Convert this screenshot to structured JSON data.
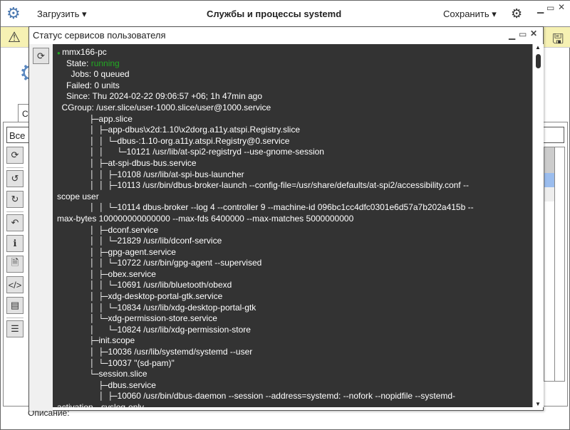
{
  "header": {
    "load_label": "Загрузить",
    "title": "Службы и процессы systemd",
    "save_label": "Сохранить"
  },
  "background": {
    "tab_label": "С",
    "filter_value": "Все",
    "description_label": "Описание:"
  },
  "dialog": {
    "title": "Статус сервисов пользователя",
    "status_color": "#22aa22",
    "lines": [
      {
        "p": "",
        "t": "mmx166-pc",
        "dot": true
      },
      {
        "p": "  ",
        "k": "State: ",
        "v": "running"
      },
      {
        "p": "   ",
        "t": "Jobs: 0 queued"
      },
      {
        "p": "  ",
        "t": "Failed: 0 units"
      },
      {
        "p": "  ",
        "t": "Since: Thu 2024-02-22 09:06:57 +06; 1h 47min ago"
      },
      {
        "p": " ",
        "t": "CGroup: /user.slice/user-1000.slice/user@1000.service"
      },
      {
        "p": "       ├─",
        "t": "app.slice"
      },
      {
        "p": "       │ ├─",
        "t": "app-dbus\\x2d:1.10\\x2dorg.a11y.atspi.Registry.slice"
      },
      {
        "p": "       │ │ └─",
        "t": "dbus-:1.10-org.a11y.atspi.Registry@0.service"
      },
      {
        "p": "       │ │   └─",
        "t": "10121 /usr/lib/at-spi2-registryd --use-gnome-session"
      },
      {
        "p": "       │ ├─",
        "t": "at-spi-dbus-bus.service"
      },
      {
        "p": "       │ │ ├─",
        "t": "10108 /usr/lib/at-spi-bus-launcher"
      },
      {
        "p": "       │ │ ├─",
        "t": "10113 /usr/bin/dbus-broker-launch --config-file=/usr/share/defaults/at-spi2/accessibility.conf --"
      },
      {
        "p": "",
        "t": "scope user"
      },
      {
        "p": "       │ │ └─",
        "t": "10114 dbus-broker --log 4 --controller 9 --machine-id 096bc1cc4dfc0301e6d57a7b202a415b --"
      },
      {
        "p": "",
        "t": "max-bytes 100000000000000 --max-fds 6400000 --max-matches 5000000000"
      },
      {
        "p": "       │ ├─",
        "t": "dconf.service"
      },
      {
        "p": "       │ │ └─",
        "t": "21829 /usr/lib/dconf-service"
      },
      {
        "p": "       │ ├─",
        "t": "gpg-agent.service"
      },
      {
        "p": "       │ │ └─",
        "t": "10722 /usr/bin/gpg-agent --supervised"
      },
      {
        "p": "       │ ├─",
        "t": "obex.service"
      },
      {
        "p": "       │ │ └─",
        "t": "10691 /usr/lib/bluetooth/obexd"
      },
      {
        "p": "       │ ├─",
        "t": "xdg-desktop-portal-gtk.service"
      },
      {
        "p": "       │ │ └─",
        "t": "10834 /usr/lib/xdg-desktop-portal-gtk"
      },
      {
        "p": "       │ └─",
        "t": "xdg-permission-store.service"
      },
      {
        "p": "       │   └─",
        "t": "10824 /usr/lib/xdg-permission-store"
      },
      {
        "p": "       ├─",
        "t": "init.scope"
      },
      {
        "p": "       │ ├─",
        "t": "10036 /usr/lib/systemd/systemd --user"
      },
      {
        "p": "       │ └─",
        "t": "10037 \"(sd-pam)\""
      },
      {
        "p": "       └─",
        "t": "session.slice"
      },
      {
        "p": "         ├─",
        "t": "dbus.service"
      },
      {
        "p": "         │ ├─",
        "t": "10060 /usr/bin/dbus-daemon --session --address=systemd: --nofork --nopidfile --systemd-"
      },
      {
        "p": "",
        "t": "activation --syslog-only"
      }
    ]
  }
}
